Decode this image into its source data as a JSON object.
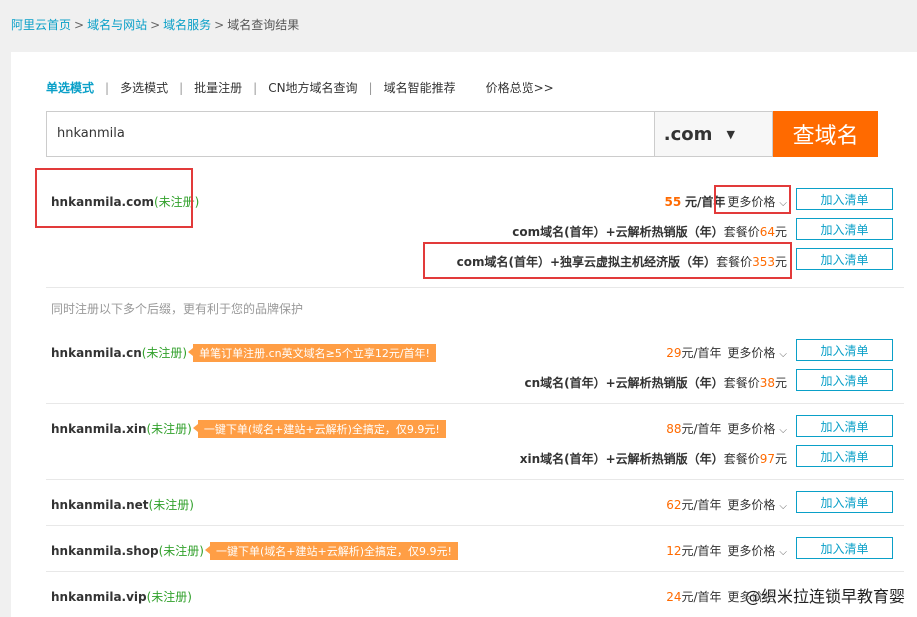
{
  "breadcrumb": [
    {
      "label": "阿里云首页",
      "link": true
    },
    {
      "label": "域名与网站",
      "link": true
    },
    {
      "label": "域名服务",
      "link": true
    },
    {
      "label": "域名查询结果",
      "link": false
    }
  ],
  "breadcrumb_sep": ">",
  "modes": [
    "单选模式",
    "多选模式",
    "批量注册",
    "CN地方域名查询",
    "域名智能推荐"
  ],
  "mode_sep": "|",
  "price_overview": "价格总览>>",
  "search": {
    "value": "hnkanmila",
    "suffix": ".com",
    "suffix_caret": "▼",
    "button": "查域名"
  },
  "add_label": "加入清单",
  "more_prices": "更多价格",
  "chevron": "⌵",
  "status_unregistered": "(未注册)",
  "hint": "同时注册以下多个后缀，更有利于您的品牌保护",
  "primary": {
    "domain": "hnkanmila.com",
    "price": "55",
    "unit": "元/首年",
    "bundles": [
      {
        "label": "com域名(首年）+云解析热销版（年）",
        "tail": "套餐价",
        "price": "64",
        "unit": "元"
      },
      {
        "label": "com域名(首年）+独享云虚拟主机经济版（年）",
        "tail": "套餐价",
        "price": "353",
        "unit": "元"
      }
    ]
  },
  "others": [
    {
      "domain": "hnkanmila.cn",
      "promo": "单笔订单注册.cn英文域名≥5个立享12元/首年!",
      "price": "29",
      "unit": "元/首年",
      "bundles": [
        {
          "label": "cn域名(首年）+云解析热销版（年）",
          "tail": "套餐价",
          "price": "38",
          "unit": "元"
        }
      ]
    },
    {
      "domain": "hnkanmila.xin",
      "promo": "一键下单(域名+建站+云解析)全搞定，仅9.9元!",
      "price": "88",
      "unit": "元/首年",
      "bundles": [
        {
          "label": "xin域名(首年）+云解析热销版（年）",
          "tail": "套餐价",
          "price": "97",
          "unit": "元"
        }
      ]
    },
    {
      "domain": "hnkanmila.net",
      "promo": "",
      "price": "62",
      "unit": "元/首年",
      "bundles": []
    },
    {
      "domain": "hnkanmila.shop",
      "promo": "一键下单(域名+建站+云解析)全搞定，仅9.9元!",
      "price": "12",
      "unit": "元/首年",
      "bundles": []
    },
    {
      "domain": "hnkanmila.vip",
      "promo": "",
      "price": "24",
      "unit": "元/首年",
      "bundles": []
    }
  ],
  "watermark": "@织米拉连锁早教育婴",
  "colors": {
    "accent": "#0aa0c8",
    "orange": "#ff6a00",
    "promo": "#ff9e45",
    "green": "#32a12c",
    "highlight": "#e23a3a"
  }
}
